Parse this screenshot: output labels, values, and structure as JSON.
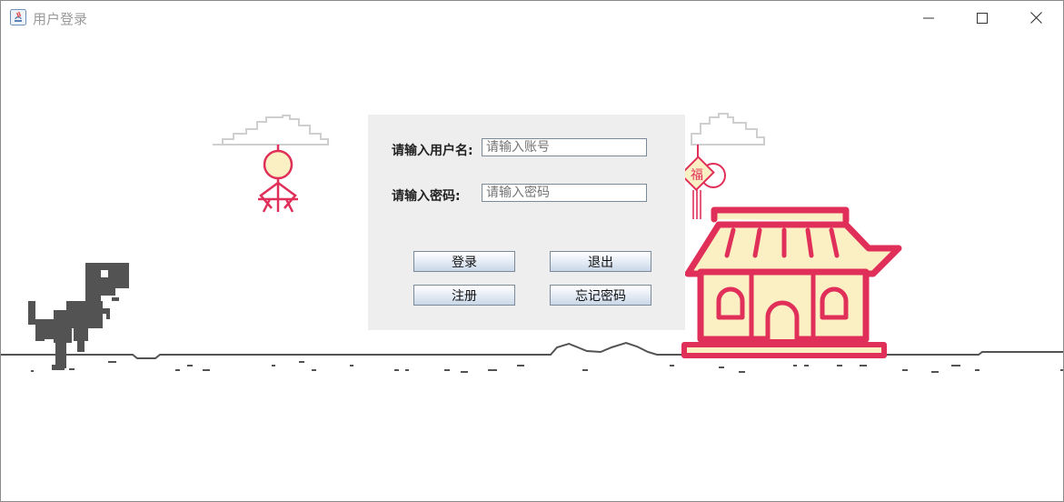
{
  "window": {
    "title": "用户登录",
    "controls": [
      "minimize-icon",
      "maximize-icon",
      "close-icon"
    ]
  },
  "login": {
    "username_label": "请输入用户名:",
    "username_placeholder": "请输入账号",
    "password_label": "请输入密码:",
    "password_placeholder": "请输入密码",
    "login_button": "登录",
    "exit_button": "退出",
    "register_button": "注册",
    "forgot_button": "忘记密码"
  },
  "scene": {
    "lantern_char": "福",
    "colors": {
      "accent": "#e0305a",
      "house_fill": "#fbefc4",
      "dino": "#535353",
      "ground": "#535353",
      "cloud": "#cfcfcf"
    }
  }
}
